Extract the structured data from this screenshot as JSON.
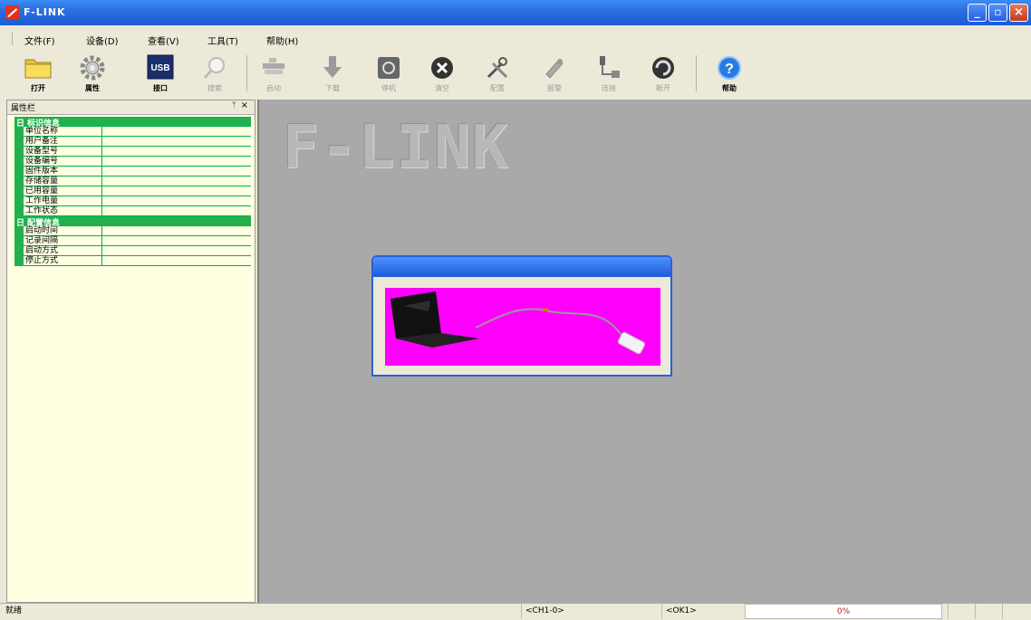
{
  "window": {
    "title": "F-LINK"
  },
  "menu": [
    "文件(F)",
    "设备(D)",
    "查看(V)",
    "工具(T)",
    "帮助(H)"
  ],
  "toolbar": [
    {
      "label": "打开",
      "icon": "folder-icon",
      "enabled": true
    },
    {
      "label": "属性",
      "icon": "gear-icon",
      "enabled": true
    },
    {
      "label": "接口",
      "icon": "usb-icon",
      "enabled": true
    },
    {
      "label": "搜索",
      "icon": "magnifier-icon",
      "enabled": false
    },
    {
      "label": "启动",
      "icon": "device-icon",
      "enabled": false
    },
    {
      "label": "下载",
      "icon": "download-icon",
      "enabled": false
    },
    {
      "label": "停机",
      "icon": "stop-icon",
      "enabled": false
    },
    {
      "label": "清空",
      "icon": "clear-icon",
      "enabled": false
    },
    {
      "label": "配置",
      "icon": "tools-icon",
      "enabled": false
    },
    {
      "label": "报警",
      "icon": "alarm-icon",
      "enabled": false
    },
    {
      "label": "连接",
      "icon": "connect-icon",
      "enabled": false
    },
    {
      "label": "断开",
      "icon": "disconnect-icon",
      "enabled": false
    },
    {
      "label": "帮助",
      "icon": "help-icon",
      "enabled": true
    }
  ],
  "panel": {
    "title": "属性栏",
    "pin": "ᛘ",
    "close": "×",
    "categories": [
      {
        "toggle": "日",
        "name": "标识信息",
        "items": [
          "单位名称",
          "用户备注",
          "设备型号",
          "设备编号",
          "固件版本",
          "存储容量",
          "已用容量",
          "工作电量",
          "工作状态"
        ]
      },
      {
        "toggle": "日",
        "name": "配置信息",
        "items": [
          "启动时间",
          "记录间隔",
          "启动方式",
          "停止方式"
        ]
      }
    ]
  },
  "main": {
    "brand": "F-LINK"
  },
  "status": {
    "left": "就绪",
    "s1": "<CH1-0>",
    "s2": "<OK1>",
    "s3": "0%"
  },
  "colors": {
    "accent": "#22b14c",
    "dialog_body": "#ff00ff",
    "main_bg": "#a9a9a9"
  }
}
